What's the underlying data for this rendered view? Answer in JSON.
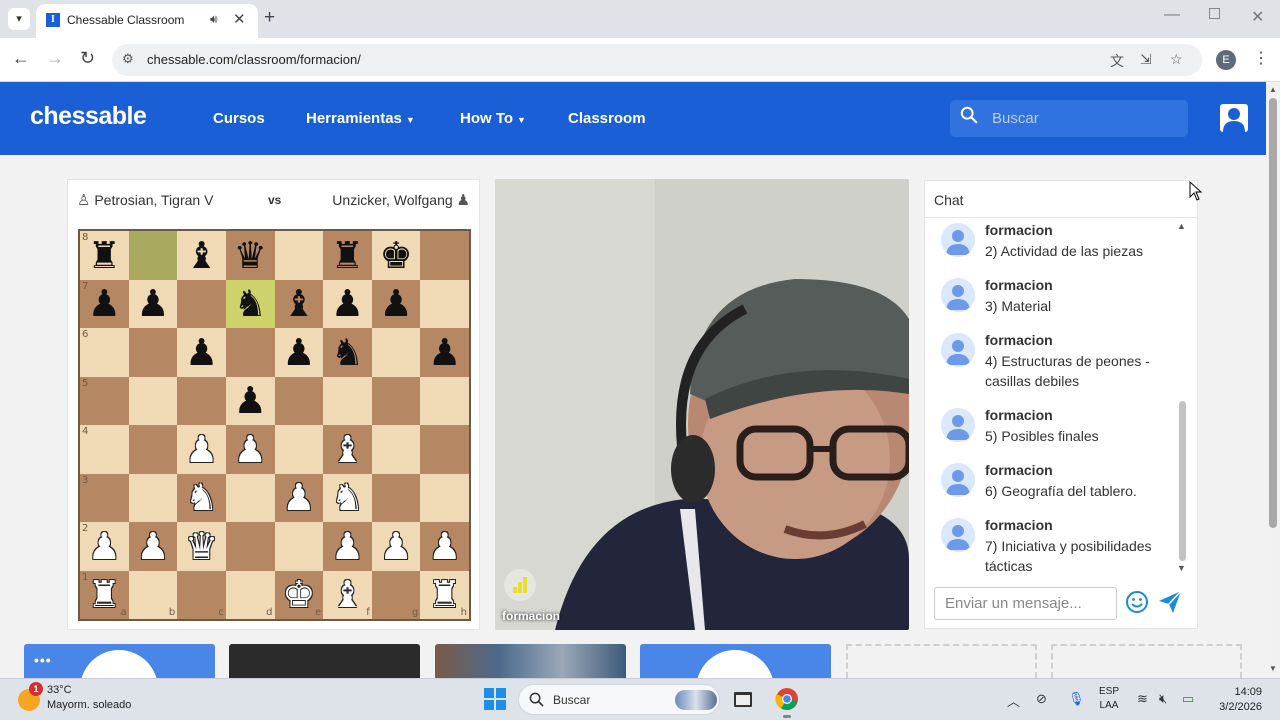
{
  "browser": {
    "tab_title": "Chessable Classroom",
    "tab_favicon": "I",
    "url": "chessable.com/classroom/formacion/",
    "profile_initial": "E",
    "icons": [
      "tab-search-icon",
      "speaker-icon",
      "close-icon",
      "new-tab-icon",
      "back-icon",
      "forward-icon",
      "reload-icon",
      "site-info-icon",
      "translate-icon",
      "install-icon",
      "star-icon",
      "kebab-icon"
    ]
  },
  "site": {
    "logo": "chessable",
    "nav": [
      {
        "label": "Cursos",
        "dropdown": false
      },
      {
        "label": "Herramientas",
        "dropdown": true
      },
      {
        "label": "How To",
        "dropdown": true
      },
      {
        "label": "Classroom",
        "dropdown": false
      }
    ],
    "search_placeholder": "Buscar",
    "brand_color": "#1a5fd6"
  },
  "game": {
    "white_player": "Petrosian, Tigran V",
    "vs": "vs",
    "black_player": "Unzicker, Wolfgang",
    "board": [
      [
        "r",
        "",
        "b",
        "q",
        "",
        "r",
        "k",
        ""
      ],
      [
        "p",
        "p",
        "",
        "n",
        "b",
        "p",
        "p",
        ""
      ],
      [
        "",
        "",
        "p",
        "",
        "p",
        "n",
        "",
        "p"
      ],
      [
        "",
        "",
        "",
        "p",
        "",
        "",
        "",
        ""
      ],
      [
        "",
        "",
        "P",
        "P",
        "",
        "B",
        "",
        ""
      ],
      [
        "",
        "",
        "N",
        "",
        "P",
        "N",
        "",
        ""
      ],
      [
        "P",
        "P",
        "Q",
        "",
        "",
        "P",
        "P",
        "P"
      ],
      [
        "R",
        "",
        "",
        "",
        "K",
        "B",
        "",
        "R"
      ]
    ],
    "highlighted_squares": [
      "b8",
      "d7"
    ],
    "ranks": [
      "8",
      "7",
      "6",
      "5",
      "4",
      "3",
      "2",
      "1"
    ],
    "files": [
      "a",
      "b",
      "c",
      "d",
      "e",
      "f",
      "g",
      "h"
    ]
  },
  "video": {
    "speaker_label": "formacion"
  },
  "chat": {
    "title": "Chat",
    "messages": [
      {
        "user": "formacion",
        "text": "2) Actividad de las piezas"
      },
      {
        "user": "formacion",
        "text": "3) Material"
      },
      {
        "user": "formacion",
        "text": "4) Estructuras de peones - casillas debiles"
      },
      {
        "user": "formacion",
        "text": "5) Posibles finales"
      },
      {
        "user": "formacion",
        "text": "6) Geografía del tablero."
      },
      {
        "user": "formacion",
        "text": "7) Iniciativa y posibilidades tácticas"
      }
    ],
    "input_placeholder": "Enviar un mensaje..."
  },
  "thumbnails": [
    {
      "kind": "avatar",
      "color": "#4a86e8",
      "dots": "•••"
    },
    {
      "kind": "video",
      "color": "#2b2b2b"
    },
    {
      "kind": "video",
      "color": "#5a6a7e"
    },
    {
      "kind": "avatar",
      "color": "#4a86e8"
    },
    {
      "kind": "empty"
    },
    {
      "kind": "empty"
    }
  ],
  "taskbar": {
    "weather_badge": "1",
    "temperature": "33°C",
    "condition": "Mayorm. soleado",
    "search_label": "Buscar",
    "lang_top": "ESP",
    "lang_bottom": "LAA",
    "time": "14:09",
    "date": "3/2/2026"
  }
}
